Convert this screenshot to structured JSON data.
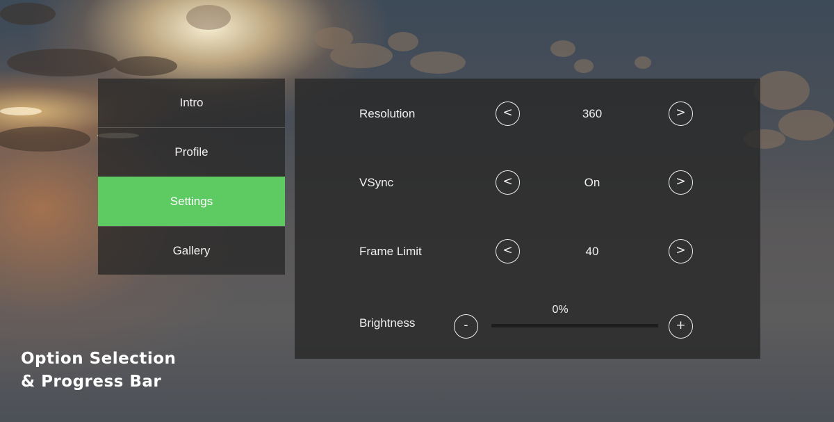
{
  "menu": {
    "items": [
      {
        "label": "Intro",
        "active": false
      },
      {
        "label": "Profile",
        "active": false
      },
      {
        "label": "Settings",
        "active": true
      },
      {
        "label": "Gallery",
        "active": false
      }
    ]
  },
  "settings": {
    "resolution": {
      "label": "Resolution",
      "value": "360",
      "prev_icon": "<",
      "next_icon": ">"
    },
    "vsync": {
      "label": "VSync",
      "value": "On",
      "prev_icon": "<",
      "next_icon": ">"
    },
    "frame_limit": {
      "label": "Frame Limit",
      "value": "40",
      "prev_icon": "<",
      "next_icon": ">"
    },
    "brightness": {
      "label": "Brightness",
      "value_text": "0%",
      "progress": 0,
      "minus_icon": "-",
      "plus_icon": "+"
    }
  },
  "caption": {
    "line1": "Option Selection",
    "line2": "& Progress Bar"
  },
  "colors": {
    "accent": "#5dcb62",
    "panel": "#282828",
    "text": "#f0f0f0"
  }
}
